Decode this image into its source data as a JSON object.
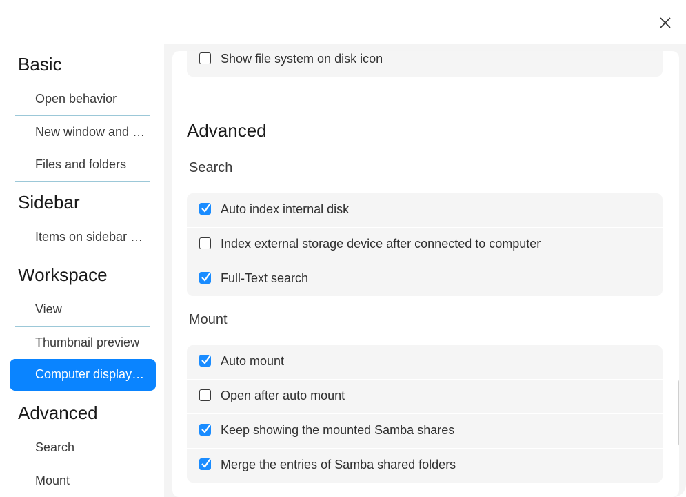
{
  "sidebar": {
    "groups": {
      "basic": "Basic",
      "sidebar": "Sidebar",
      "workspace": "Workspace",
      "advanced": "Advanced"
    },
    "items": {
      "open_behavior": "Open behavior",
      "new_window": "New window and …",
      "files_folders": "Files and folders",
      "items_on_sidebar": "Items on sidebar …",
      "view": "View",
      "thumbnail_preview": "Thumbnail preview",
      "computer_display": "Computer display…",
      "search": "Search",
      "mount": "Mount"
    },
    "active_item": "Computer display…"
  },
  "content": {
    "top_partial_option": {
      "label": "Show file system on disk icon",
      "checked": false
    },
    "section_title": "Advanced",
    "search": {
      "title": "Search",
      "options": [
        {
          "label": "Auto index internal disk",
          "checked": true
        },
        {
          "label": "Index external storage device after connected to computer",
          "checked": false
        },
        {
          "label": "Full-Text search",
          "checked": true
        }
      ]
    },
    "mount": {
      "title": "Mount",
      "options": [
        {
          "label": "Auto mount",
          "checked": true
        },
        {
          "label": "Open after auto mount",
          "checked": false
        },
        {
          "label": "Keep showing the mounted Samba shares",
          "checked": true
        },
        {
          "label": "Merge the entries of Samba shared folders",
          "checked": true
        }
      ]
    }
  },
  "colors": {
    "accent": "#0a84ff",
    "checkbox_checked": "#1a8cff",
    "separator": "#9cc8d8"
  },
  "icons": {
    "close": "close-icon",
    "checked": "checkmark-icon"
  }
}
